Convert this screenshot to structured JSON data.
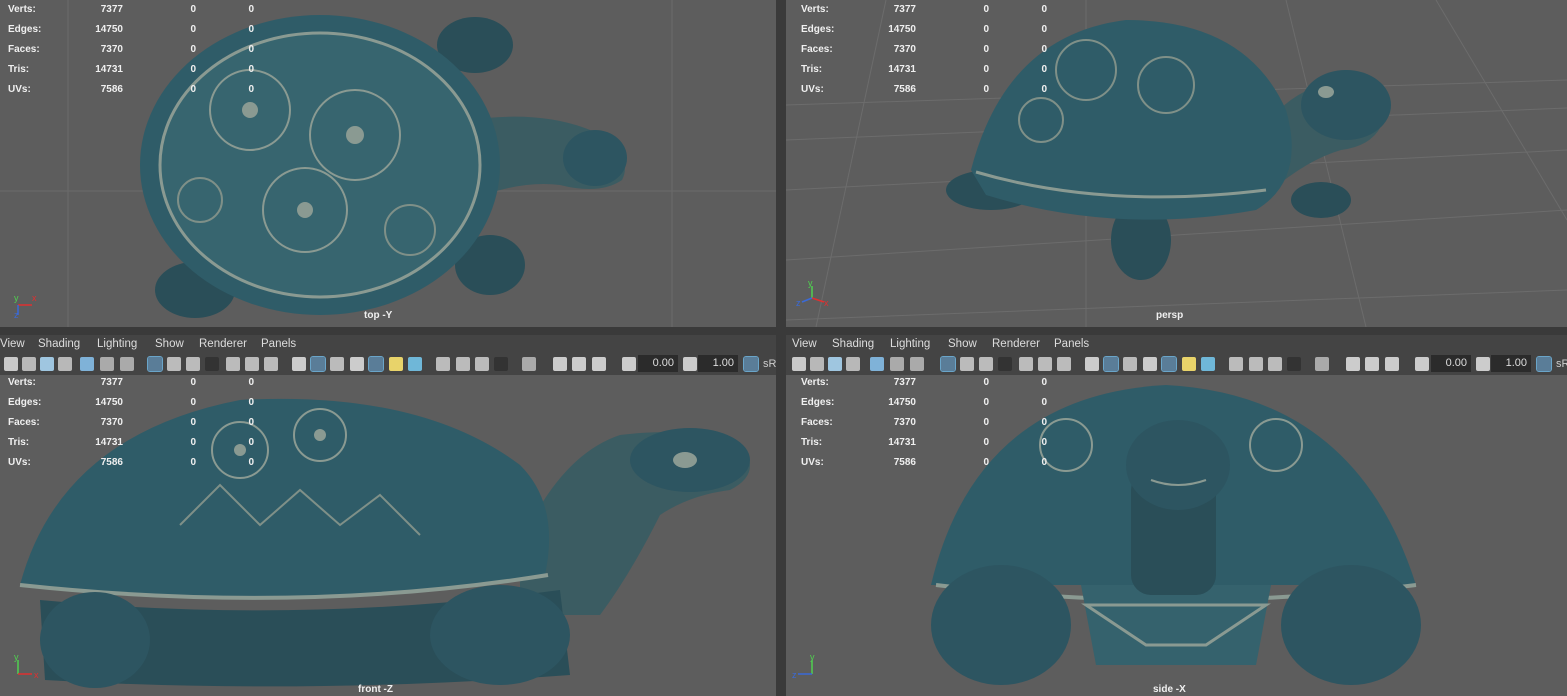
{
  "stats_labels": {
    "verts": "Verts:",
    "edges": "Edges:",
    "faces": "Faces:",
    "tris": "Tris:",
    "uvs": "UVs:"
  },
  "stats_values": {
    "verts": [
      "7377",
      "0",
      "0"
    ],
    "edges": [
      "14750",
      "0",
      "0"
    ],
    "faces": [
      "7370",
      "0",
      "0"
    ],
    "tris": [
      "14731",
      "0",
      "0"
    ],
    "uvs": [
      "7586",
      "0",
      "0"
    ]
  },
  "viewports": {
    "top": {
      "label": "top -Y"
    },
    "persp": {
      "label": "persp"
    },
    "front": {
      "label": "front -Z"
    },
    "side": {
      "label": "side -X"
    }
  },
  "menu": {
    "view": "View",
    "shading": "Shading",
    "lighting": "Lighting",
    "show": "Show",
    "renderer": "Renderer",
    "panels": "Panels"
  },
  "toolbar": {
    "field1": "0.00",
    "field2": "1.00",
    "srgb": "sR"
  },
  "axes": {
    "x": "x",
    "y": "y",
    "z": "z"
  },
  "colors": {
    "viewport_bg": "#5d5d5d",
    "turtle_teal": "#2f5c68",
    "turtle_dark": "#1c3840",
    "turtle_light": "#8a9a92",
    "panel_bg": "#444444",
    "accent": "#5a7d98"
  }
}
